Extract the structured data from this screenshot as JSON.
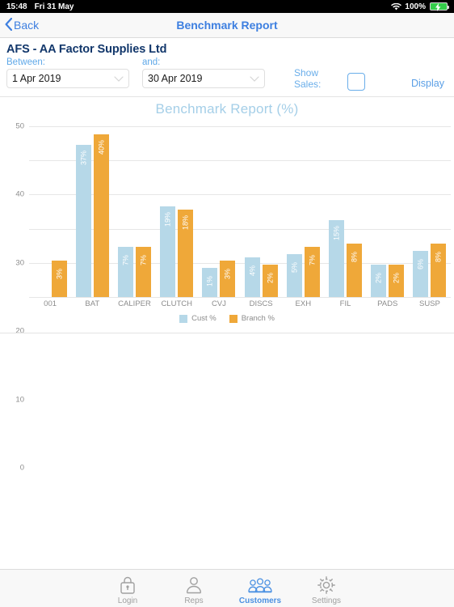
{
  "status_bar": {
    "time": "15:48",
    "date": "Fri 31 May",
    "battery_percent": "100%",
    "wifi_icon": "wifi-icon",
    "battery_icon": "battery-charging-icon"
  },
  "nav": {
    "back_label": "Back",
    "back_icon": "chevron-left-icon",
    "title": "Benchmark Report",
    "accent": "#3d7fe0"
  },
  "filters": {
    "company": "AFS - AA Factor Supplies Ltd",
    "between_label": "Between:",
    "and_label": "and:",
    "date_from": "1 Apr 2019",
    "date_to": "30 Apr 2019",
    "caret_icon": "chevron-down-icon",
    "show_sales_label": "Show Sales:",
    "show_sales_checked": false,
    "display_label": "Display"
  },
  "chart_data": {
    "type": "bar",
    "title": "Benchmark Report (%)",
    "xlabel": "",
    "ylabel": "",
    "ylim": [
      0,
      50
    ],
    "yticks": [
      0,
      10,
      20,
      30,
      40,
      50
    ],
    "grid": true,
    "legend_position": "bottom",
    "categories": [
      "001",
      "BAT",
      "CALIPER",
      "CLUTCH",
      "CVJ",
      "DISCS",
      "EXH",
      "FIL",
      "PADS",
      "SUSP"
    ],
    "series": [
      {
        "name": "Cust %",
        "color": "#b6d8e8",
        "values": [
          0,
          37,
          7,
          19,
          1,
          4,
          5,
          15,
          2,
          6
        ],
        "labels": [
          "",
          "37%",
          "7%",
          "19%",
          "1%",
          "4%",
          "5%",
          "15%",
          "2%",
          "6%"
        ]
      },
      {
        "name": "Branch %",
        "color": "#efa839",
        "values": [
          3,
          40,
          7,
          18,
          3,
          2,
          7,
          8,
          2,
          8
        ],
        "labels": [
          "3%",
          "40%",
          "7%",
          "18%",
          "3%",
          "2%",
          "7%",
          "8%",
          "2%",
          "8%"
        ]
      }
    ],
    "title_color": "#a5cfe8"
  },
  "tabbar": {
    "items": [
      {
        "label": "Login",
        "icon": "lock-icon",
        "active": false
      },
      {
        "label": "Reps",
        "icon": "person-icon",
        "active": false
      },
      {
        "label": "Customers",
        "icon": "group-icon",
        "active": true
      },
      {
        "label": "Settings",
        "icon": "gear-icon",
        "active": false
      }
    ],
    "active_color": "#4a90e2"
  }
}
